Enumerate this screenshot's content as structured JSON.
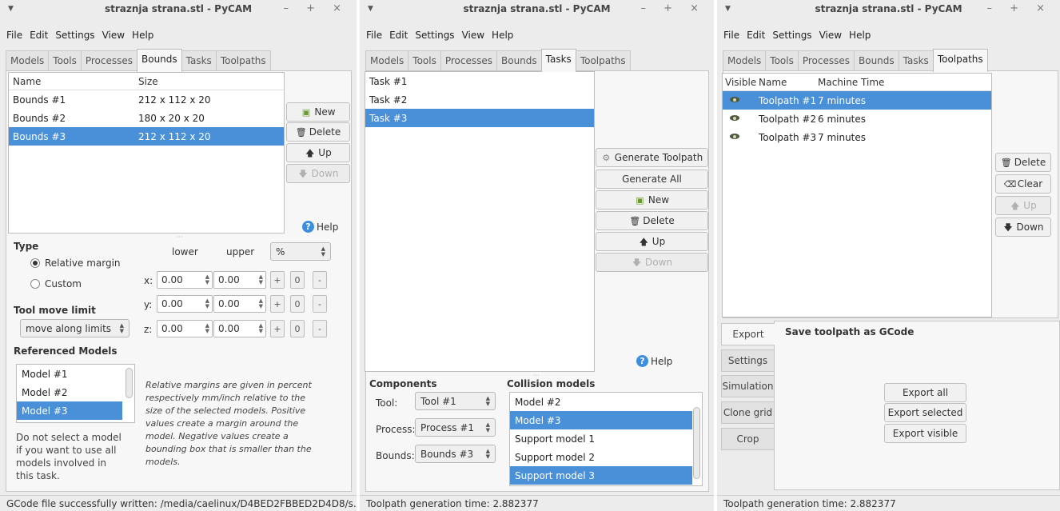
{
  "windows": [
    {
      "title": "straznja strana.stl - PyCAM",
      "menu": [
        "File",
        "Edit",
        "Settings",
        "View",
        "Help"
      ],
      "tabs": [
        "Models",
        "Tools",
        "Processes",
        "Bounds",
        "Tasks",
        "Toolpaths"
      ],
      "active_tab": "Bounds",
      "bounds_table": {
        "headers": [
          "Name",
          "Size"
        ],
        "rows": [
          {
            "name": "Bounds #1",
            "size": "212 x 112 x 20"
          },
          {
            "name": "Bounds #2",
            "size": "180 x 20 x 20"
          },
          {
            "name": "Bounds #3",
            "size": "212 x 112 x 20"
          }
        ]
      },
      "buttons": {
        "new": "New",
        "delete": "Delete",
        "up": "Up",
        "down": "Down",
        "help": "Help"
      },
      "type_section": {
        "title": "Type",
        "relative": "Relative margin",
        "custom": "Custom",
        "lower": "lower",
        "upper": "upper",
        "unit": "%",
        "axes": [
          {
            "axis": "x:",
            "lower": "0.00",
            "upper": "0.00"
          },
          {
            "axis": "y:",
            "lower": "0.00",
            "upper": "0.00"
          },
          {
            "axis": "z:",
            "lower": "0.00",
            "upper": "0.00"
          }
        ],
        "plus": "+",
        "zero": "0",
        "minus": "-"
      },
      "tool_move": {
        "title": "Tool move limit",
        "value": "move along limits"
      },
      "referenced": {
        "title": "Referenced Models",
        "items": [
          "Model #1",
          "Model #2",
          "Model #3"
        ],
        "hint": "Do not select a model if you want to use all models involved in this task.",
        "note": "Relative margins are given in percent respectively mm/inch relative to the size of the selected models. Positive values create a margin around the model. Negative values create a bounding box that is smaller than the models."
      },
      "status": "GCode file successfully written: /media/caelinux/D4BED2FBBED2D4D8/s..."
    },
    {
      "title": "straznja strana.stl - PyCAM",
      "menu": [
        "File",
        "Edit",
        "Settings",
        "View",
        "Help"
      ],
      "tabs": [
        "Models",
        "Tools",
        "Processes",
        "Bounds",
        "Tasks",
        "Toolpaths"
      ],
      "active_tab": "Tasks",
      "tasks": [
        "Task #1",
        "Task #2",
        "Task #3"
      ],
      "buttons": {
        "generate": "Generate Toolpath",
        "generate_all": "Generate All",
        "new": "New",
        "delete": "Delete",
        "up": "Up",
        "down": "Down",
        "help": "Help"
      },
      "components": {
        "title": "Components",
        "tool_label": "Tool:",
        "tool_value": "Tool #1",
        "process_label": "Process:",
        "process_value": "Process #1",
        "bounds_label": "Bounds:",
        "bounds_value": "Bounds #3"
      },
      "collision": {
        "title": "Collision models",
        "items": [
          "Model #2",
          "Model #3",
          "Support model 1",
          "Support model 2",
          "Support model 3"
        ]
      },
      "status": "Toolpath generation time: 2.882377"
    },
    {
      "title": "straznja strana.stl - PyCAM",
      "menu": [
        "File",
        "Edit",
        "Settings",
        "View",
        "Help"
      ],
      "tabs": [
        "Models",
        "Tools",
        "Processes",
        "Bounds",
        "Tasks",
        "Toolpaths"
      ],
      "active_tab": "Toolpaths",
      "toolpath_table": {
        "headers": [
          "Visible",
          "Name",
          "Machine Time"
        ],
        "rows": [
          {
            "name": "Toolpath #1",
            "time": "7 minutes"
          },
          {
            "name": "Toolpath #2",
            "time": "6 minutes"
          },
          {
            "name": "Toolpath #3",
            "time": "7 minutes"
          }
        ]
      },
      "buttons": {
        "delete": "Delete",
        "clear": "Clear",
        "up": "Up",
        "down": "Down"
      },
      "side_tabs": [
        "Export",
        "Settings",
        "Simulation",
        "Clone grid",
        "Crop"
      ],
      "export": {
        "title": "Save toolpath as GCode",
        "all": "Export all",
        "selected": "Export selected",
        "visible": "Export visible"
      },
      "status": "Toolpath generation time: 2.882377"
    }
  ],
  "colors": {
    "selection": "#4a90d9",
    "window_bg": "#ececec"
  }
}
